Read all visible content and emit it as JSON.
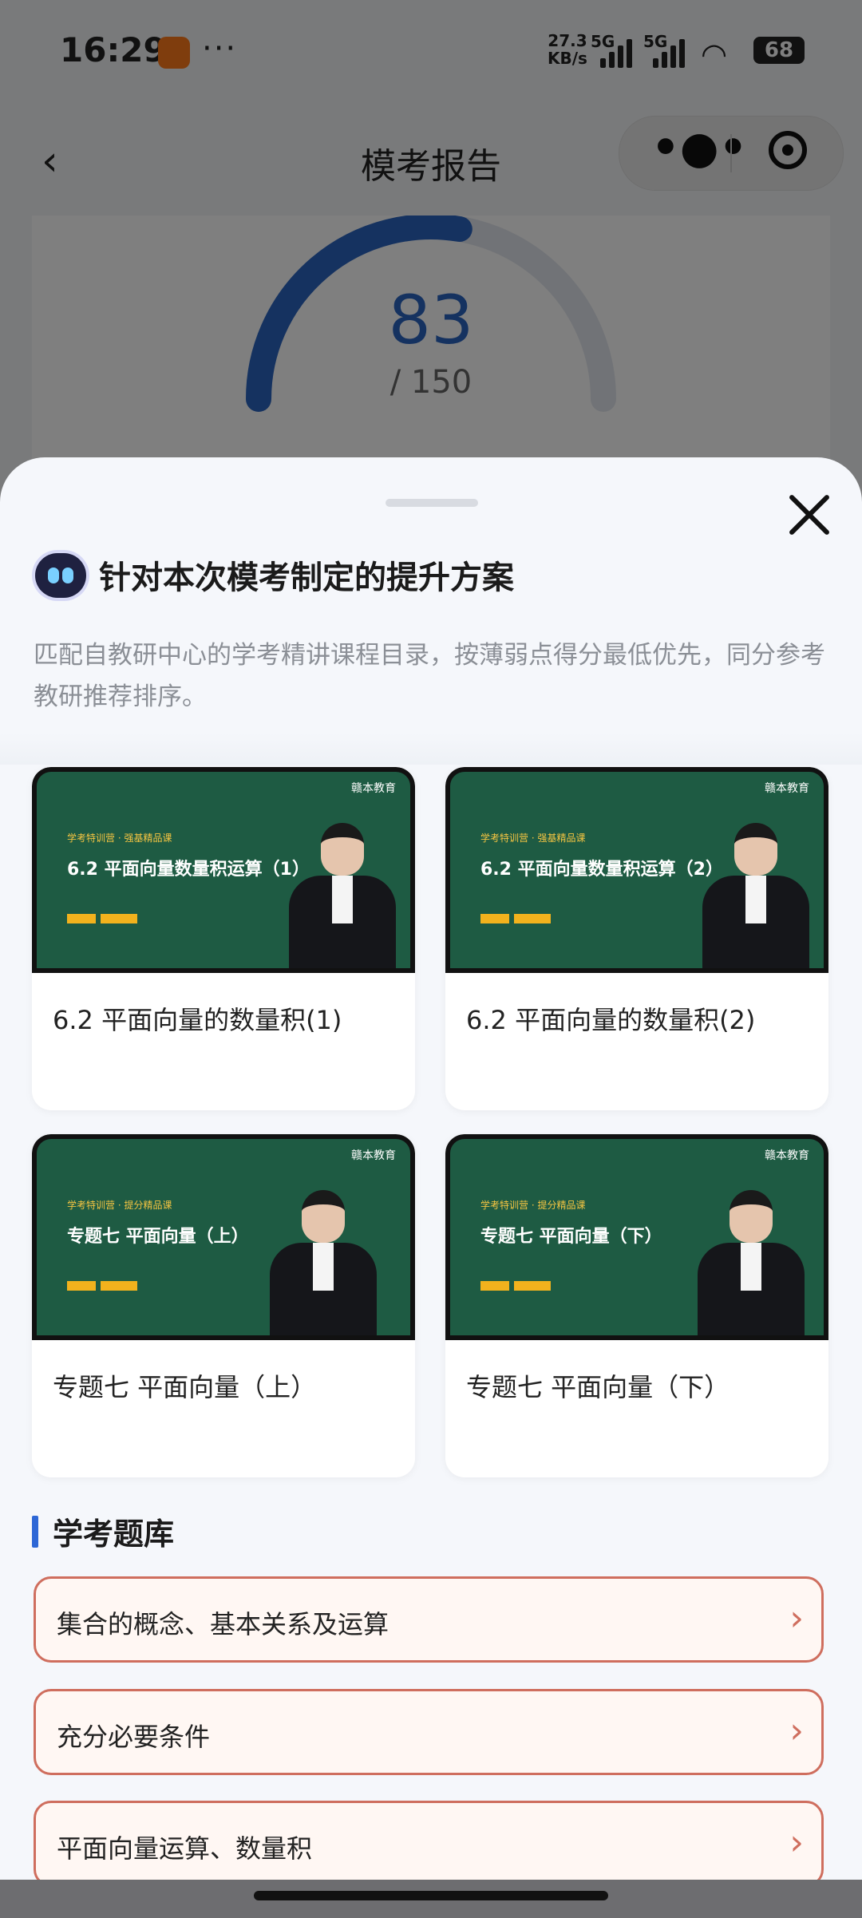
{
  "status": {
    "time": "16:29",
    "dots": "···",
    "speed_value": "27.3",
    "speed_unit": "KB/s",
    "sim1": "5G",
    "sim2": "5G",
    "battery": "68"
  },
  "nav": {
    "title": "模考报告",
    "back_icon": "chevron-left-icon"
  },
  "score": {
    "value": "83",
    "total": "/ 150",
    "fraction": 0.553
  },
  "sheet": {
    "title": "针对本次模考制定的提升方案",
    "description": "匹配自教研中心的学考精讲课程目录，按薄弱点得分最低优先，同分参考教研推荐排序。",
    "courses": [
      {
        "title": "6.2 平面向量的数量积(1)",
        "thumb_logo": "赣本教育",
        "thumb_tag": "学考特训营 · 强基精品课",
        "thumb_lesson": "6.2 平面向量数量积运算（1）"
      },
      {
        "title": "6.2 平面向量的数量积(2)",
        "thumb_logo": "赣本教育",
        "thumb_tag": "学考特训营 · 强基精品课",
        "thumb_lesson": "6.2 平面向量数量积运算（2）"
      },
      {
        "title": "专题七 平面向量（上）",
        "thumb_logo": "赣本教育",
        "thumb_tag": "学考特训营 · 提分精品课",
        "thumb_lesson": "专题七 平面向量（上）"
      },
      {
        "title": "专题七 平面向量（下）",
        "thumb_logo": "赣本教育",
        "thumb_tag": "学考特训营 · 提分精品课",
        "thumb_lesson": "专题七 平面向量（下）"
      }
    ],
    "section_title": "学考题库",
    "questions": [
      {
        "label": "集合的概念、基本关系及运算"
      },
      {
        "label": "充分必要条件"
      },
      {
        "label": "平面向量运算、数量积"
      }
    ],
    "chevron": "›"
  },
  "colors": {
    "accent": "#2d67d6",
    "question_border": "#cf6e5e",
    "gauge_fill": "#2a64c0"
  }
}
